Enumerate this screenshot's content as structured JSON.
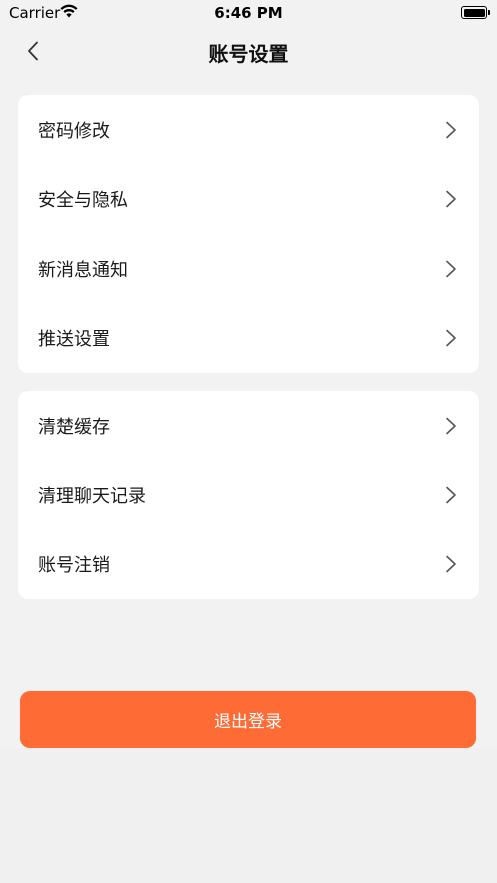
{
  "status_bar": {
    "carrier": "Carrier",
    "time": "6:46 PM",
    "wifi_icon": "wifi-icon",
    "battery_icon": "battery-icon"
  },
  "nav": {
    "title": "账号设置",
    "back_icon": "chevron-left-icon"
  },
  "group1": {
    "items": [
      {
        "label": "密码修改"
      },
      {
        "label": "安全与隐私"
      },
      {
        "label": "新消息通知"
      },
      {
        "label": "推送设置"
      }
    ]
  },
  "group2": {
    "items": [
      {
        "label": "清楚缓存"
      },
      {
        "label": "清理聊天记录"
      },
      {
        "label": "账号注销"
      }
    ]
  },
  "logout": {
    "label": "退出登录"
  },
  "colors": {
    "accent": "#ff6b35",
    "background": "#f2f2f2",
    "card": "#ffffff",
    "chevron": "#555555"
  }
}
